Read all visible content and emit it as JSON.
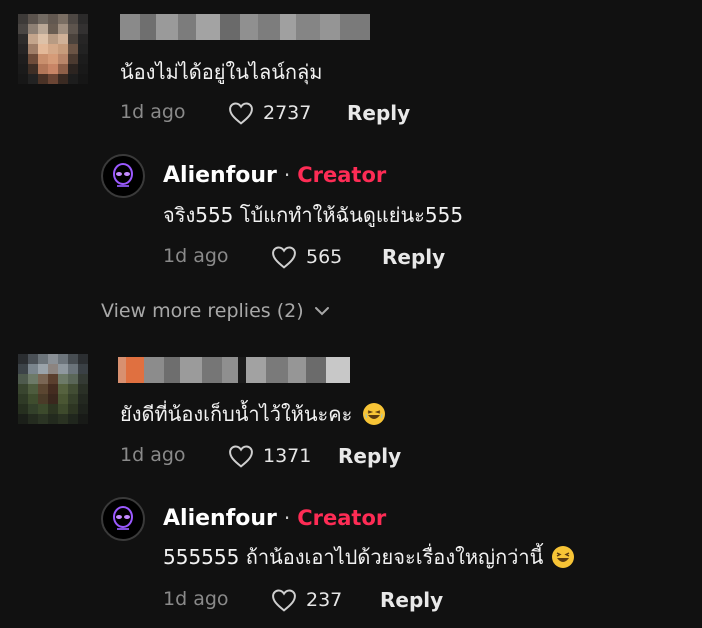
{
  "comments": [
    {
      "text": "น้องไม่ได้อยู่ในไลน์กลุ่ม",
      "time": "1d ago",
      "likes": "2737",
      "reply_label": "Reply"
    },
    {
      "text": "ยังดีที่น้องเก็บน้ำไว้ให้นะคะ",
      "time": "1d ago",
      "likes": "1371",
      "reply_label": "Reply"
    }
  ],
  "replies": [
    {
      "author": "Alienfour",
      "separator": "·",
      "badge": "Creator",
      "text": "จริง555 โบ้แกทำให้ฉันดูแย่นะ555",
      "time": "1d ago",
      "likes": "565",
      "reply_label": "Reply"
    },
    {
      "author": "Alienfour",
      "separator": "·",
      "badge": "Creator",
      "text": "555555 ถ้าน้องเอาไปด้วยจะเรื่องใหญ่กว่านี้",
      "time": "1d ago",
      "likes": "237",
      "reply_label": "Reply"
    }
  ],
  "view_more": "View more replies (2)",
  "icons": {
    "heart": "heart-outline-icon",
    "chevron": "chevron-down-icon",
    "emoji": "laughing-emoji-icon"
  },
  "colors": {
    "background": "#111111",
    "creator_badge": "#fe2c55",
    "muted_text": "#8a8a8a"
  }
}
